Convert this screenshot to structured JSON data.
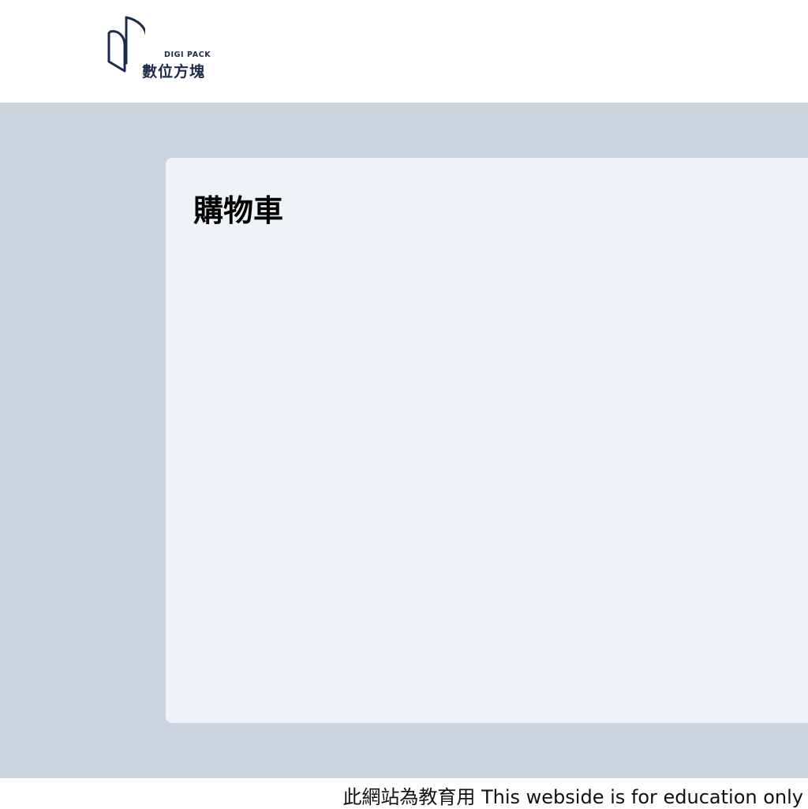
{
  "header": {
    "logo": {
      "brand_en": "DIGI PACK",
      "brand_zh": "數位方塊",
      "icon": "digipack-logo-icon",
      "color": "#1c2b4d"
    }
  },
  "main": {
    "background": "#cbd5e0",
    "card": {
      "title": "購物車",
      "background": "#eff3f8"
    }
  },
  "footer": {
    "notice": "此網站為教育用 This webside is for education only"
  }
}
